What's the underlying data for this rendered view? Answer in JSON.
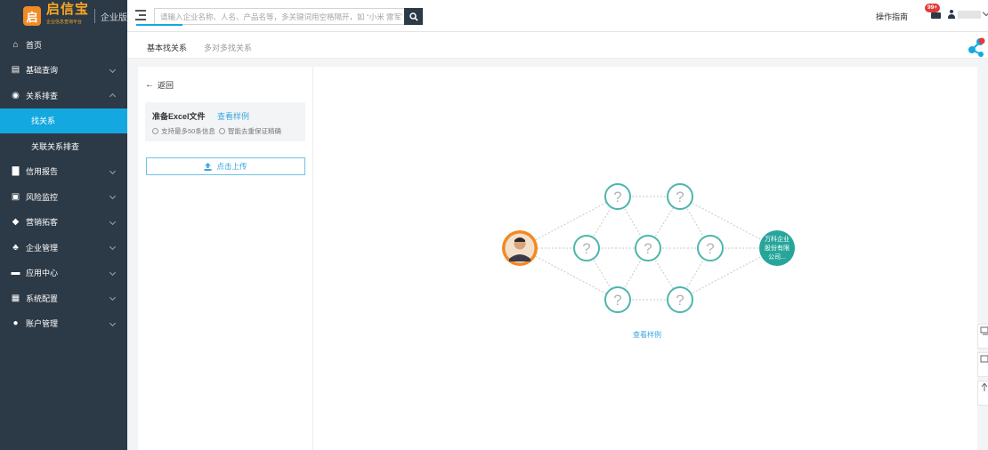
{
  "brand": {
    "logo_char": "启",
    "name": "启信宝",
    "tagline": "企业信息查询平台",
    "edition": "企业版"
  },
  "search": {
    "placeholder": "请输入企业名称、人名、产品名等，多关键词用空格隔开，如 “小米 雷军”"
  },
  "header": {
    "guide": "操作指南",
    "mail_badge": "99+"
  },
  "sidebar": {
    "items": [
      {
        "label": "首页",
        "icon": "home-icon",
        "glyph": "⌂",
        "expandable": false
      },
      {
        "label": "基础查询",
        "icon": "search-doc-icon",
        "glyph": "▤",
        "expandable": true
      },
      {
        "label": "关系排查",
        "icon": "relation-icon",
        "glyph": "◉",
        "expandable": true,
        "expanded": true,
        "children": [
          {
            "label": "找关系",
            "active": true
          },
          {
            "label": "关联关系排查",
            "active": false
          }
        ]
      },
      {
        "label": "信用报告",
        "icon": "report-icon",
        "glyph": "▇",
        "expandable": true
      },
      {
        "label": "风险监控",
        "icon": "monitor-icon",
        "glyph": "▣",
        "expandable": true
      },
      {
        "label": "营销拓客",
        "icon": "handshake-icon",
        "glyph": "◆",
        "expandable": true
      },
      {
        "label": "企业管理",
        "icon": "org-icon",
        "glyph": "♣",
        "expandable": true
      },
      {
        "label": "应用中心",
        "icon": "app-icon",
        "glyph": "▬",
        "expandable": true
      },
      {
        "label": "系统配置",
        "icon": "grid-icon",
        "glyph": "▦",
        "expandable": true
      },
      {
        "label": "账户管理",
        "icon": "account-icon",
        "glyph": "●",
        "expandable": true
      }
    ]
  },
  "tabs": [
    {
      "label": "基本找关系",
      "active": true
    },
    {
      "label": "多对多找关系",
      "active": false
    }
  ],
  "left_panel": {
    "back_label": "返回",
    "prep_title": "准备Excel文件",
    "prep_link": "查看样例",
    "notes": [
      "支持最多50条信息",
      "智能去重保证精确"
    ],
    "upload_label": "点击上传"
  },
  "graph": {
    "unknown_glyph": "?",
    "target_company": [
      "万科企业",
      "股份有限",
      "公司..."
    ],
    "example_link": "查看样例",
    "colors": {
      "node_border": "#4db6ac",
      "target_fill": "#26a69a",
      "person_border": "#f08a24",
      "link": "#c8c8c8"
    }
  },
  "colors": {
    "sidebar_bg": "#2c3946",
    "accent": "#14a8e0",
    "link": "#3aa6e0",
    "badge": "#e03b3b"
  }
}
